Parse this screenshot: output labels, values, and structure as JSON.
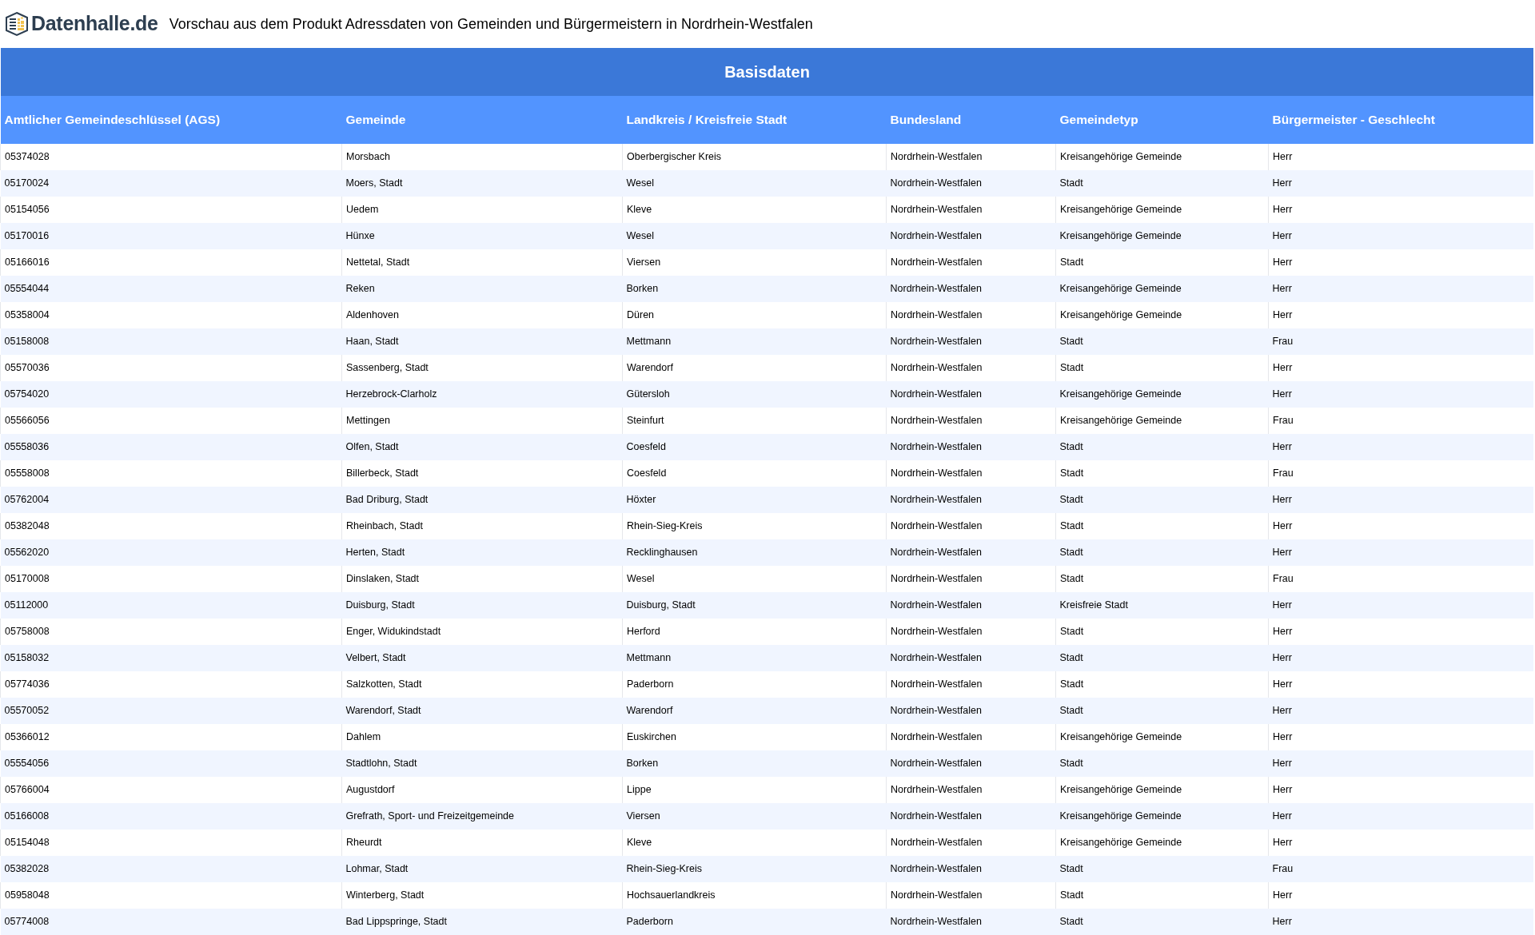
{
  "header": {
    "logo_text": "Datenhalle.de",
    "title": "Vorschau aus dem Produkt Adressdaten von Gemeinden und Bürgermeistern in Nordrhein-Westfalen"
  },
  "table": {
    "group_title": "Basisdaten",
    "columns": [
      "Amtlicher Gemeindeschlüssel (AGS)",
      "Gemeinde",
      "Landkreis / Kreisfreie Stadt",
      "Bundesland",
      "Gemeindetyp",
      "Bürgermeister - Geschlecht"
    ],
    "rows": [
      [
        "05374028",
        "Morsbach",
        "Oberbergischer Kreis",
        "Nordrhein-Westfalen",
        "Kreisangehörige Gemeinde",
        "Herr"
      ],
      [
        "05170024",
        "Moers, Stadt",
        "Wesel",
        "Nordrhein-Westfalen",
        "Stadt",
        "Herr"
      ],
      [
        "05154056",
        "Uedem",
        "Kleve",
        "Nordrhein-Westfalen",
        "Kreisangehörige Gemeinde",
        "Herr"
      ],
      [
        "05170016",
        "Hünxe",
        "Wesel",
        "Nordrhein-Westfalen",
        "Kreisangehörige Gemeinde",
        "Herr"
      ],
      [
        "05166016",
        "Nettetal, Stadt",
        "Viersen",
        "Nordrhein-Westfalen",
        "Stadt",
        "Herr"
      ],
      [
        "05554044",
        "Reken",
        "Borken",
        "Nordrhein-Westfalen",
        "Kreisangehörige Gemeinde",
        "Herr"
      ],
      [
        "05358004",
        "Aldenhoven",
        "Düren",
        "Nordrhein-Westfalen",
        "Kreisangehörige Gemeinde",
        "Herr"
      ],
      [
        "05158008",
        "Haan, Stadt",
        "Mettmann",
        "Nordrhein-Westfalen",
        "Stadt",
        "Frau"
      ],
      [
        "05570036",
        "Sassenberg, Stadt",
        "Warendorf",
        "Nordrhein-Westfalen",
        "Stadt",
        "Herr"
      ],
      [
        "05754020",
        "Herzebrock-Clarholz",
        "Gütersloh",
        "Nordrhein-Westfalen",
        "Kreisangehörige Gemeinde",
        "Herr"
      ],
      [
        "05566056",
        "Mettingen",
        "Steinfurt",
        "Nordrhein-Westfalen",
        "Kreisangehörige Gemeinde",
        "Frau"
      ],
      [
        "05558036",
        "Olfen, Stadt",
        "Coesfeld",
        "Nordrhein-Westfalen",
        "Stadt",
        "Herr"
      ],
      [
        "05558008",
        "Billerbeck, Stadt",
        "Coesfeld",
        "Nordrhein-Westfalen",
        "Stadt",
        "Frau"
      ],
      [
        "05762004",
        "Bad Driburg, Stadt",
        "Höxter",
        "Nordrhein-Westfalen",
        "Stadt",
        "Herr"
      ],
      [
        "05382048",
        "Rheinbach, Stadt",
        "Rhein-Sieg-Kreis",
        "Nordrhein-Westfalen",
        "Stadt",
        "Herr"
      ],
      [
        "05562020",
        "Herten, Stadt",
        "Recklinghausen",
        "Nordrhein-Westfalen",
        "Stadt",
        "Herr"
      ],
      [
        "05170008",
        "Dinslaken, Stadt",
        "Wesel",
        "Nordrhein-Westfalen",
        "Stadt",
        "Frau"
      ],
      [
        "05112000",
        "Duisburg, Stadt",
        "Duisburg, Stadt",
        "Nordrhein-Westfalen",
        "Kreisfreie Stadt",
        "Herr"
      ],
      [
        "05758008",
        "Enger, Widukindstadt",
        "Herford",
        "Nordrhein-Westfalen",
        "Stadt",
        "Herr"
      ],
      [
        "05158032",
        "Velbert, Stadt",
        "Mettmann",
        "Nordrhein-Westfalen",
        "Stadt",
        "Herr"
      ],
      [
        "05774036",
        "Salzkotten, Stadt",
        "Paderborn",
        "Nordrhein-Westfalen",
        "Stadt",
        "Herr"
      ],
      [
        "05570052",
        "Warendorf, Stadt",
        "Warendorf",
        "Nordrhein-Westfalen",
        "Stadt",
        "Herr"
      ],
      [
        "05366012",
        "Dahlem",
        "Euskirchen",
        "Nordrhein-Westfalen",
        "Kreisangehörige Gemeinde",
        "Herr"
      ],
      [
        "05554056",
        "Stadtlohn, Stadt",
        "Borken",
        "Nordrhein-Westfalen",
        "Stadt",
        "Herr"
      ],
      [
        "05766004",
        "Augustdorf",
        "Lippe",
        "Nordrhein-Westfalen",
        "Kreisangehörige Gemeinde",
        "Herr"
      ],
      [
        "05166008",
        "Grefrath, Sport- und Freizeitgemeinde",
        "Viersen",
        "Nordrhein-Westfalen",
        "Kreisangehörige Gemeinde",
        "Herr"
      ],
      [
        "05154048",
        "Rheurdt",
        "Kleve",
        "Nordrhein-Westfalen",
        "Kreisangehörige Gemeinde",
        "Herr"
      ],
      [
        "05382028",
        "Lohmar, Stadt",
        "Rhein-Sieg-Kreis",
        "Nordrhein-Westfalen",
        "Stadt",
        "Frau"
      ],
      [
        "05958048",
        "Winterberg, Stadt",
        "Hochsauerlandkreis",
        "Nordrhein-Westfalen",
        "Stadt",
        "Herr"
      ],
      [
        "05774008",
        "Bad Lippspringe, Stadt",
        "Paderborn",
        "Nordrhein-Westfalen",
        "Stadt",
        "Herr"
      ]
    ]
  }
}
